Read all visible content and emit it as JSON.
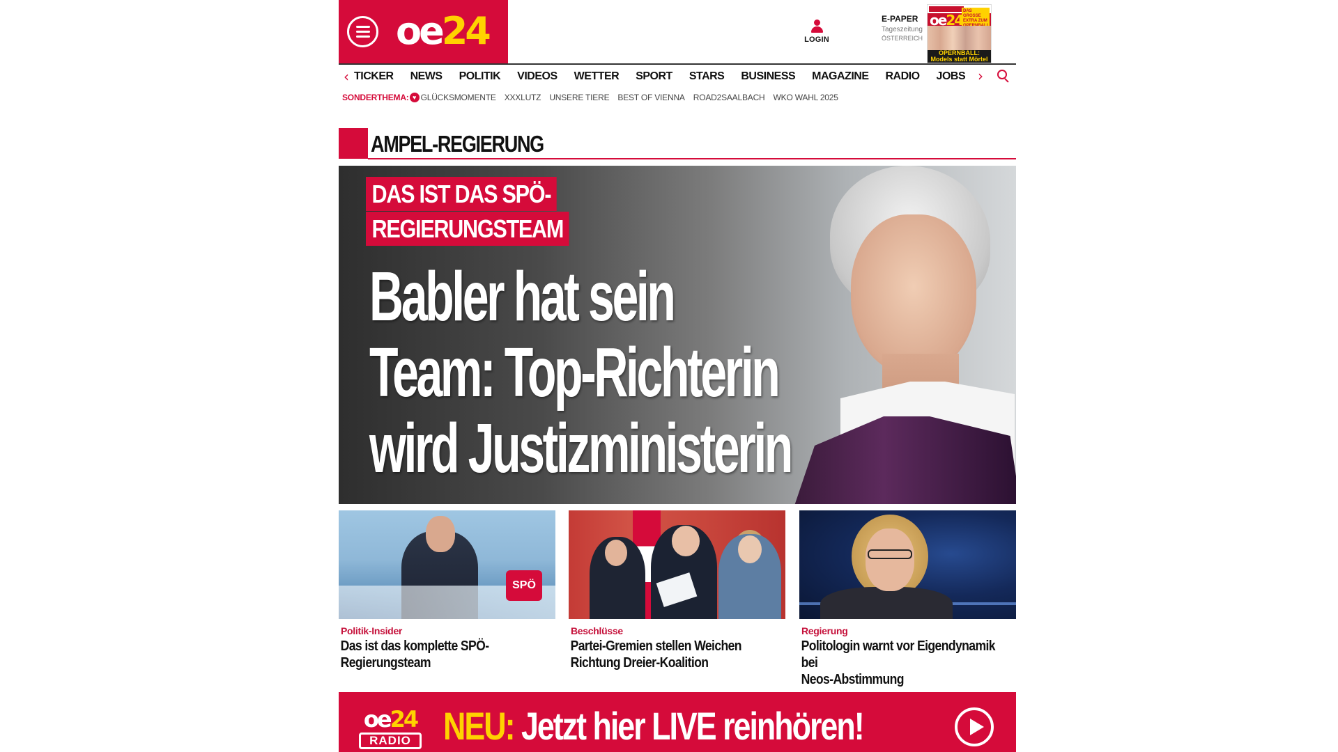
{
  "header": {
    "logo_prefix": "oe",
    "logo_suffix": "24",
    "menu_icon": "hamburger-menu-icon",
    "login_label": "LOGIN",
    "epaper": {
      "title": "E-PAPER",
      "line1": "Tageszeitung",
      "line2": "ÖSTERREICH",
      "cover_caption": "OPERNBALL: Models statt Mörtel",
      "cover_badge": "DAS GROSSE EXTRA ZUM OPERNBALL"
    }
  },
  "nav": {
    "items": [
      "TICKER",
      "NEWS",
      "POLITIK",
      "VIDEOS",
      "WETTER",
      "SPORT",
      "STARS",
      "BUSINESS",
      "MAGAZINE",
      "RADIO",
      "JOBS"
    ],
    "prev_arrow": "‹",
    "next_arrow": "›"
  },
  "subnav": {
    "label": "SONDERTHEMA:",
    "items": [
      "GLÜCKSMOMENTE",
      "XXXLUTZ",
      "UNSERE TIERE",
      "BEST OF VIENNA",
      "ROAD2SAALBACH",
      "WKO WAHL 2025"
    ]
  },
  "section": {
    "title": "AMPEL-REGIERUNG"
  },
  "hero": {
    "kicker_line1": "DAS IST DAS SPÖ-",
    "kicker_line2": "REGIERUNGSTEAM",
    "headline_line1": "Babler hat sein",
    "headline_line2": "Team: Top-Richterin",
    "headline_line3": "wird Justizministerin"
  },
  "teasers": [
    {
      "category": "Politik-Insider",
      "title_line1": "Das ist das komplette SPÖ-",
      "title_line2": "Regierungsteam",
      "image_label": "SPÖ"
    },
    {
      "category": "Beschlüsse",
      "title_line1": "Partei-Gremien stellen Weichen",
      "title_line2": "Richtung Dreier-Koalition"
    },
    {
      "category": "Regierung",
      "title_line1": "Politologin warnt vor Eigendynamik bei",
      "title_line2": "Neos-Abstimmung"
    }
  ],
  "radio_banner": {
    "logo_prefix": "oe",
    "logo_suffix": "24",
    "logo_tag": "RADIO",
    "highlight": "NEU:",
    "text": " Jetzt hier LIVE reinhören!"
  },
  "colors": {
    "brand_red": "#d50b3a",
    "brand_yellow": "#ffd200"
  }
}
